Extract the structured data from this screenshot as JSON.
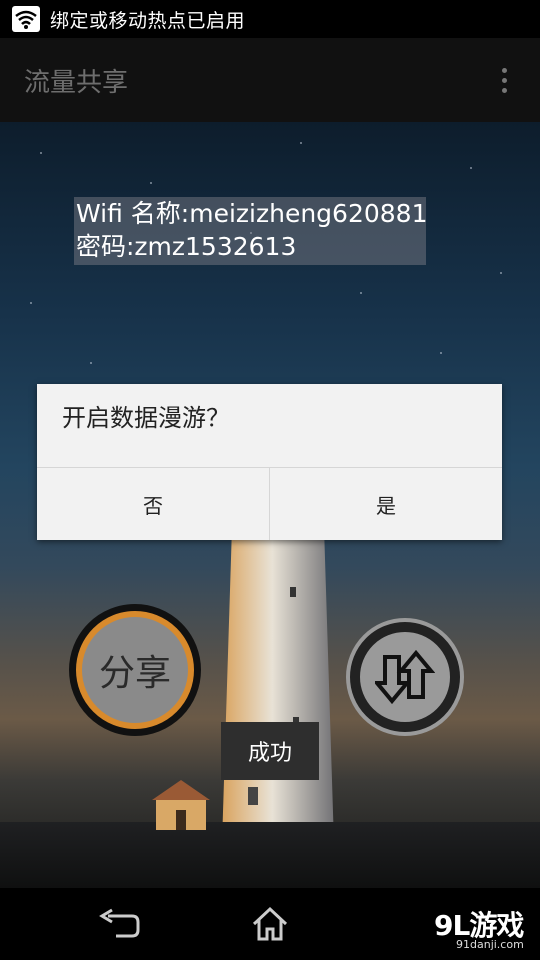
{
  "status_bar": {
    "icon": "wifi-hotspot-icon",
    "text": "绑定或移动热点已启用"
  },
  "action_bar": {
    "title": "流量共享",
    "overflow_icon": "more-vertical-icon"
  },
  "wifi_info": {
    "name_line": "Wifi 名称:meizizheng620881",
    "password_line": "密码:zmz1532613"
  },
  "dialog": {
    "message": "开启数据漫游？",
    "no_label": "否",
    "yes_label": "是"
  },
  "share_button": {
    "label": "分享"
  },
  "transfer_button": {
    "icon": "up-down-arrows-icon"
  },
  "toast": {
    "text": "成功"
  },
  "nav_bar": {
    "back_icon": "back-icon",
    "home_icon": "home-icon"
  },
  "watermark": {
    "logo": "9L游戏",
    "url": "91danji.com"
  },
  "colors": {
    "accent_orange": "#d88a2c",
    "dialog_bg": "#f2f2f2"
  }
}
